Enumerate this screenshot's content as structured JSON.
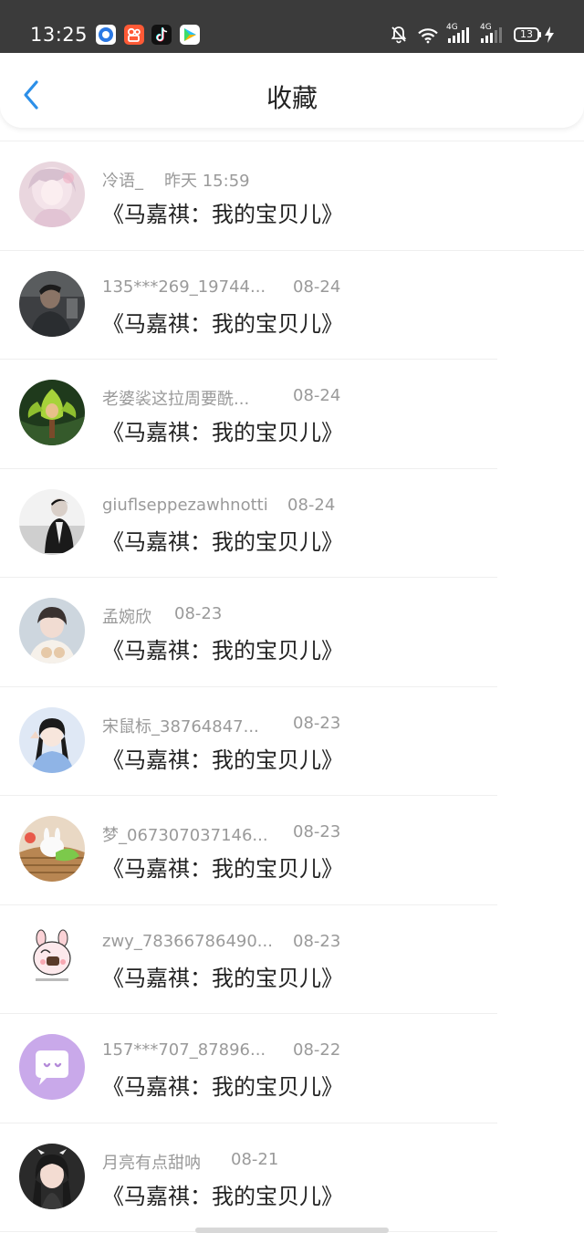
{
  "status_bar": {
    "time": "13:25",
    "battery": "13",
    "network_labels": [
      "4G",
      "4G"
    ]
  },
  "header": {
    "title": "收藏",
    "back_icon": "chevron-left-icon",
    "accent": "#2c8fe8"
  },
  "items": [
    {
      "name": "冷语_",
      "time": "昨天 15:59",
      "title": "《马嘉祺：我的宝贝儿》"
    },
    {
      "name": "135***269_19744...",
      "time": "08-24",
      "title": "《马嘉祺：我的宝贝儿》"
    },
    {
      "name": "老婆裟这拉周要酰...",
      "time": "08-24",
      "title": "《马嘉祺：我的宝贝儿》"
    },
    {
      "name": "giuflseppezawhnotti",
      "time": "08-24",
      "title": "《马嘉祺：我的宝贝儿》"
    },
    {
      "name": "孟婉欣",
      "time": "08-23",
      "title": "《马嘉祺：我的宝贝儿》"
    },
    {
      "name": "宋鼠标_38764847...",
      "time": "08-23",
      "title": "《马嘉祺：我的宝贝儿》"
    },
    {
      "name": "梦_067307037146...",
      "time": "08-23",
      "title": "《马嘉祺：我的宝贝儿》"
    },
    {
      "name": "zwy_78366786490...",
      "time": "08-23",
      "title": "《马嘉祺：我的宝贝儿》"
    },
    {
      "name": "157***707_87896...",
      "time": "08-22",
      "title": "《马嘉祺：我的宝贝儿》"
    },
    {
      "name": "月亮有点甜呐",
      "time": "08-21",
      "title": "《马嘉祺：我的宝贝儿》"
    }
  ]
}
